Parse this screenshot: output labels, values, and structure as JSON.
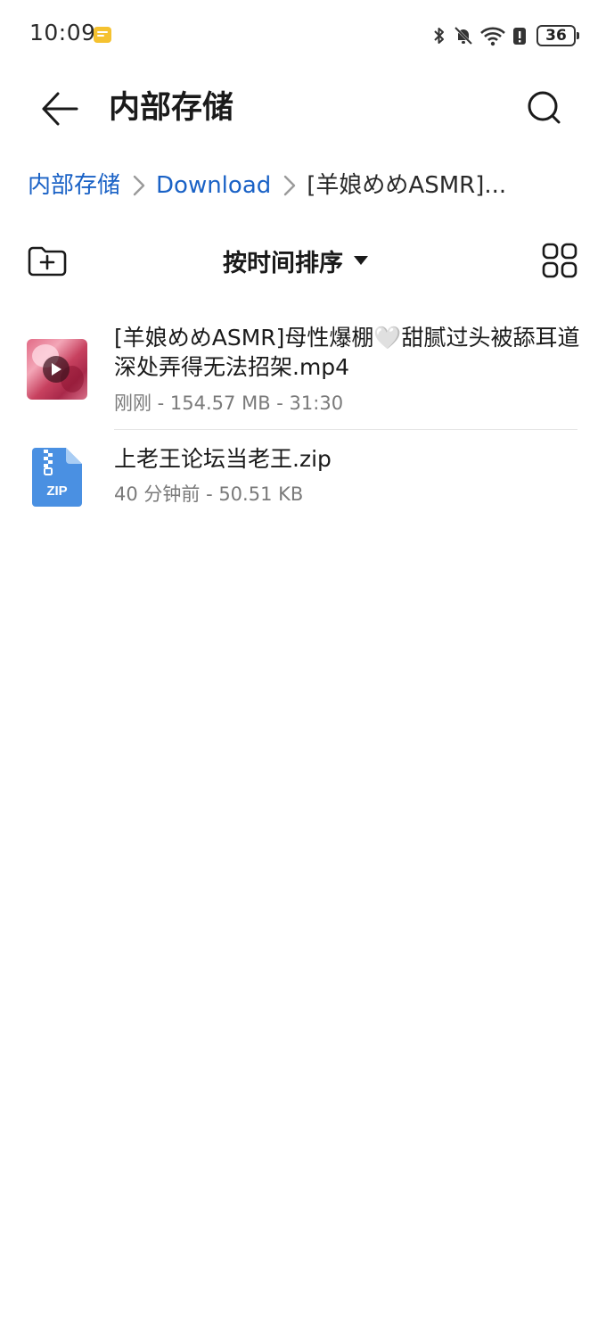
{
  "status_bar": {
    "time": "10:09",
    "battery": "36",
    "icons": [
      "notification-app-icon",
      "bluetooth-icon",
      "mute-icon",
      "wifi-icon",
      "battery-saver-icon",
      "battery-icon"
    ]
  },
  "header": {
    "title": "内部存储",
    "back_icon": "arrow-left-icon",
    "search_icon": "search-icon"
  },
  "breadcrumb": {
    "items": [
      {
        "label": "内部存储"
      },
      {
        "label": "Download"
      },
      {
        "label": "[羊娘めめASMR]..."
      }
    ]
  },
  "toolbar": {
    "sort_label": "按时间排序",
    "new_folder_icon": "new-folder-icon",
    "grid_icon": "grid-view-icon"
  },
  "files": [
    {
      "name": "[羊娘めめASMR]母性爆棚🤍甜腻过头被舔耳道深处弄得无法招架.mp4",
      "meta": "刚刚 - 154.57 MB - 31:30",
      "type": "video"
    },
    {
      "name": "上老王论坛当老王.zip",
      "meta": "40 分钟前 - 50.51 KB",
      "type": "zip"
    }
  ],
  "colors": {
    "link": "#1a62c6",
    "zip_icon": "#4a90e2",
    "text_primary": "#1a1a1a",
    "text_secondary": "#7a7a7a"
  }
}
